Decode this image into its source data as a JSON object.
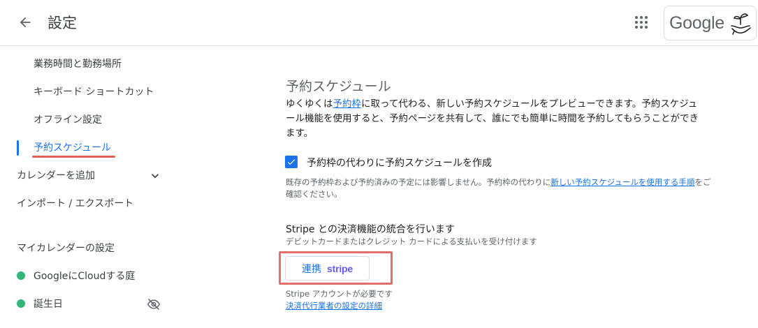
{
  "header": {
    "title": "設定",
    "brand": "Google"
  },
  "sidebar": {
    "items": [
      {
        "label": "業務時間と勤務場所"
      },
      {
        "label": "キーボード ショートカット"
      },
      {
        "label": "オフライン設定"
      },
      {
        "label": "予約スケジュール",
        "active": true
      }
    ],
    "add_calendar": "カレンダーを追加",
    "import_export": "インポート / エクスポート",
    "my_calendars_heading": "マイカレンダーの設定",
    "calendars": [
      {
        "name": "GoogleにCloudする庭",
        "color": "#33b679"
      },
      {
        "name": "誕生日",
        "color": "#33b679"
      }
    ]
  },
  "main": {
    "section_title": "予約スケジュール",
    "desc_before": "ゆくゆくは",
    "desc_link": "予約枠",
    "desc_after": "に取って代わる、新しい予約スケジュールをプレビューできます。予約スケジュール機能を使用すると、予約ページを共有して、誰にでも簡単に時間を予約してもらうことができます。",
    "checkbox_label": "予約枠の代わりに予約スケジュールを作成",
    "checkbox_checked": true,
    "note_before": "既存の予約枠および予約済みの予定には影響しません。予約枠の代わりに",
    "note_link": "新しい予約スケジュールを使用する手順",
    "note_after": "をご確認ください。",
    "stripe_title": "Stripe との決済機能の統合を行います",
    "stripe_sub": "デビットカードまたはクレジット カードによる支払いを受け付けます",
    "connect_label": "連携",
    "stripe_logo": "stripe",
    "stripe_required": "Stripe アカウントが必要です",
    "stripe_details_link": "決済代行業者の設定の詳細"
  },
  "colors": {
    "accent": "#1a73e8",
    "highlight": "#e0706a",
    "stripe": "#635bff",
    "calendar_green": "#33b679"
  }
}
